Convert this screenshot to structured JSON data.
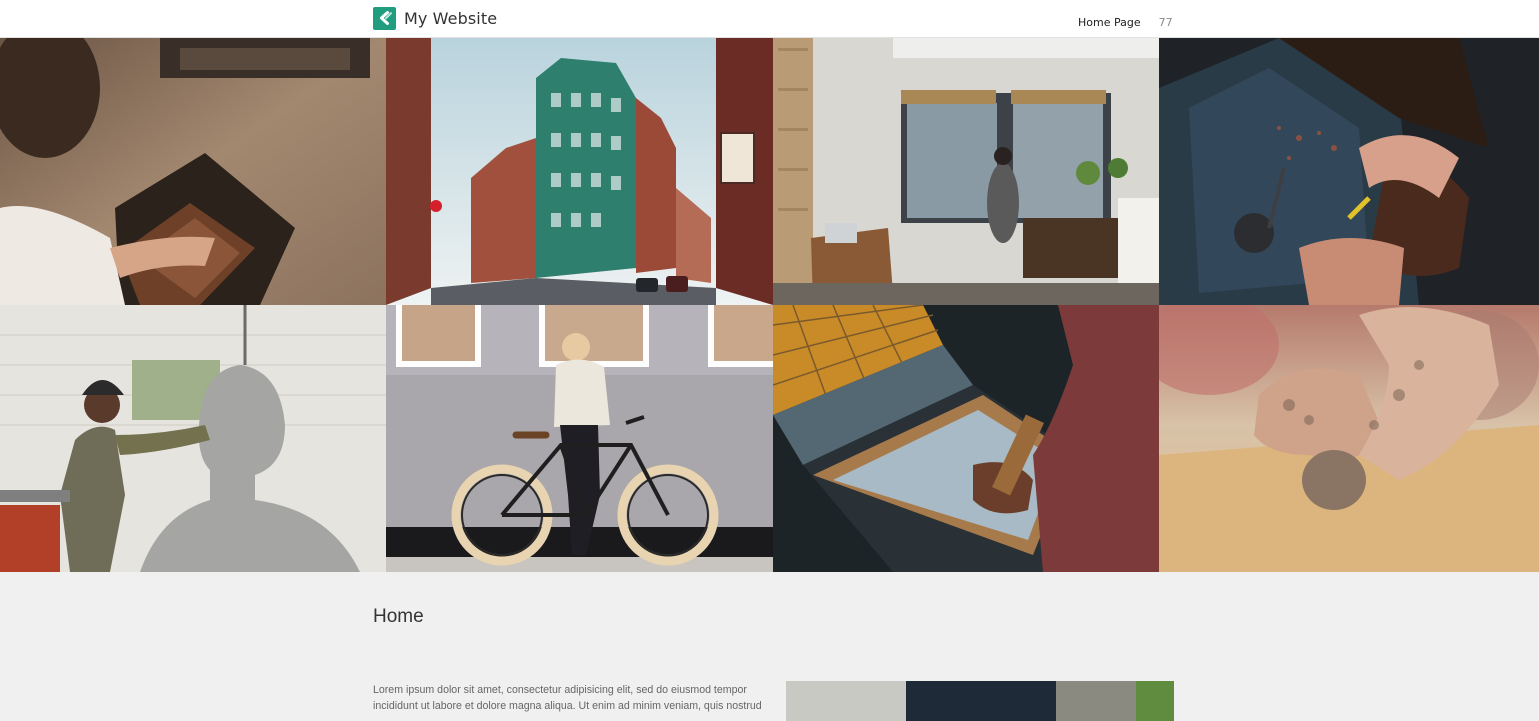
{
  "header": {
    "site_name": "My Website",
    "logo_icon": "check-chevron-icon",
    "brand_color": "#1f9d7e",
    "nav": {
      "home_label": "Home Page",
      "count": "77"
    }
  },
  "gallery": {
    "tiles": [
      {
        "subject": "woodworking-photo"
      },
      {
        "subject": "city-street-photo"
      },
      {
        "subject": "studio-interior-photo"
      },
      {
        "subject": "carving-photo"
      },
      {
        "subject": "sculptor-photo"
      },
      {
        "subject": "woman-with-bicycle-photo"
      },
      {
        "subject": "screen-printing-photo"
      },
      {
        "subject": "clay-hands-photo"
      }
    ]
  },
  "main": {
    "heading": "Home",
    "body_text": "Lorem ipsum dolor sit amet, consectetur adipisicing elit, sed do eiusmod tempor incididunt ut labore et dolore magna aliqua. Ut enim ad minim veniam, quis nostrud"
  },
  "colors": {
    "header_bg": "#ffffff",
    "page_bg": "#f0f0f0",
    "text_dark": "#333333",
    "text_muted": "#666666"
  }
}
